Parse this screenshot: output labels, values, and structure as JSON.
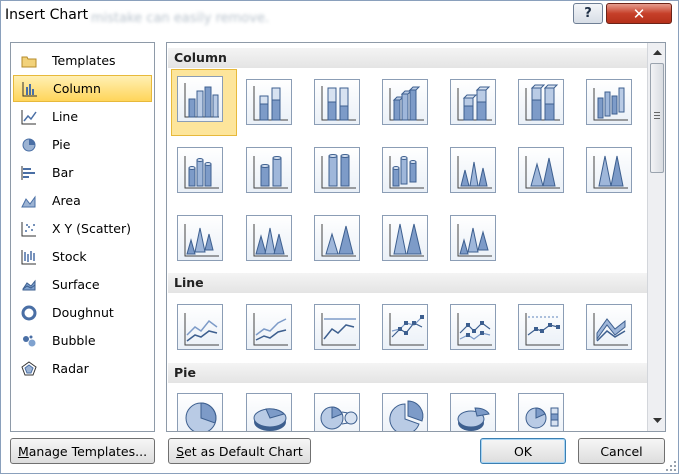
{
  "window": {
    "title": "Insert Chart",
    "background_text": "mistake can easily remove."
  },
  "titlebar_buttons": {
    "help_icon": "help-icon",
    "help_glyph": "?",
    "close_icon": "close-icon",
    "close_glyph": "✕"
  },
  "nav": {
    "items": [
      {
        "label": "Templates",
        "icon": "templates-folder-icon"
      },
      {
        "label": "Column",
        "icon": "column-chart-icon",
        "selected": true
      },
      {
        "label": "Line",
        "icon": "line-chart-icon"
      },
      {
        "label": "Pie",
        "icon": "pie-chart-icon"
      },
      {
        "label": "Bar",
        "icon": "bar-chart-icon"
      },
      {
        "label": "Area",
        "icon": "area-chart-icon"
      },
      {
        "label": "X Y (Scatter)",
        "icon": "scatter-chart-icon"
      },
      {
        "label": "Stock",
        "icon": "stock-chart-icon"
      },
      {
        "label": "Surface",
        "icon": "surface-chart-icon"
      },
      {
        "label": "Doughnut",
        "icon": "doughnut-chart-icon"
      },
      {
        "label": "Bubble",
        "icon": "bubble-chart-icon"
      },
      {
        "label": "Radar",
        "icon": "radar-chart-icon"
      }
    ]
  },
  "gallery": {
    "sections": [
      {
        "label": "Column"
      },
      {
        "label": "Line"
      },
      {
        "label": "Pie"
      }
    ]
  },
  "buttons": {
    "manage_templates_accel": "M",
    "manage_templates_rest": "anage Templates...",
    "set_default_accel": "S",
    "set_default_rest": "et as Default Chart",
    "ok": "OK",
    "cancel": "Cancel"
  },
  "colors": {
    "selected_fill": "#ffd55a",
    "selected_border": "#e7b93b",
    "accent_blue": "#4a6fa5"
  }
}
